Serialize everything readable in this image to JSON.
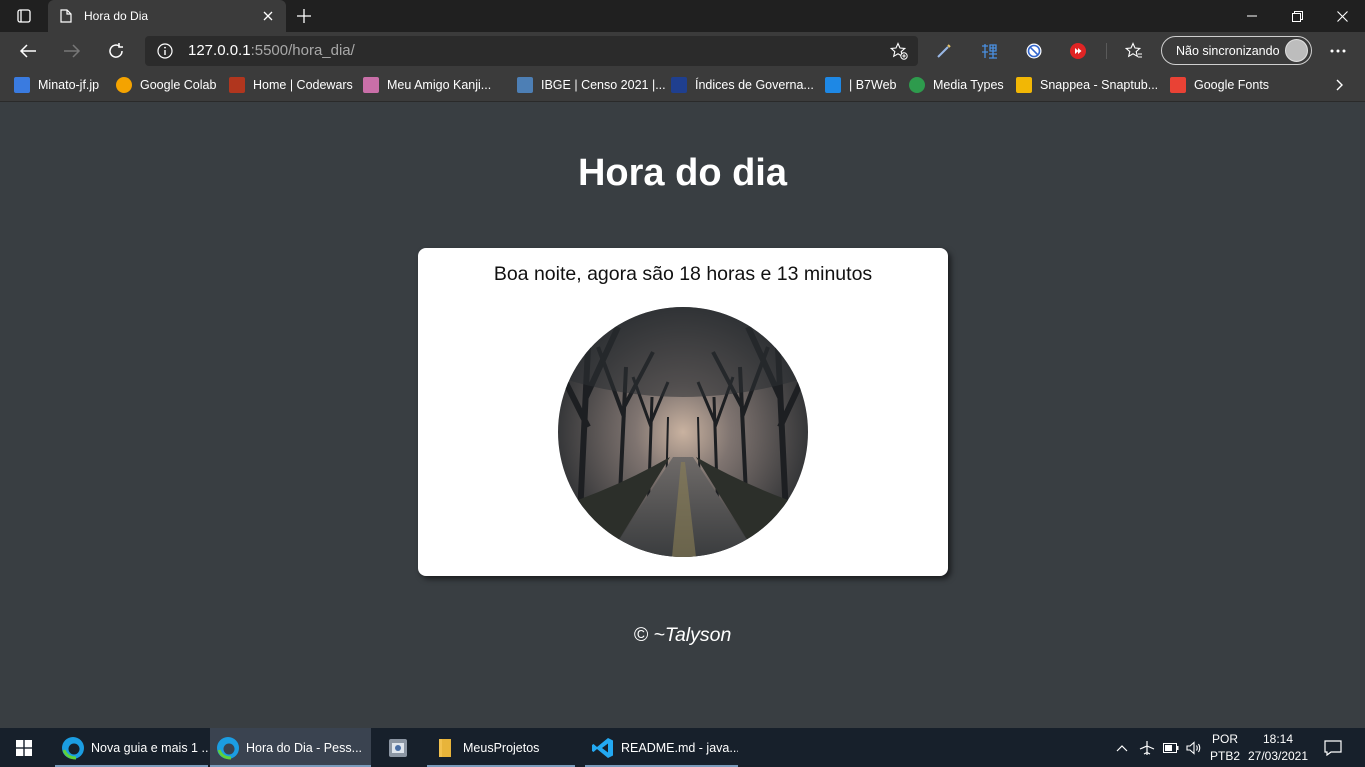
{
  "browser": {
    "tab": {
      "title": "Hora do Dia"
    },
    "address": {
      "host": "127.0.0.1",
      "rest": ":5500/hora_dia/"
    },
    "profile_label": "Não sincronizando",
    "bookmarks": [
      {
        "label": "Minato-jf.jp",
        "color": "#3a7be0"
      },
      {
        "label": "Google Colab",
        "color": "#f4a300"
      },
      {
        "label": "Home | Codewars",
        "color": "#b1361e"
      },
      {
        "label": "Meu Amigo Kanji...",
        "color": "#c96fa8"
      },
      {
        "label": "IBGE | Censo 2021 |...",
        "color": "#4d7fb5"
      },
      {
        "label": "Índices de Governa...",
        "color": "#1f3f8f"
      },
      {
        "label": "| B7Web",
        "color": "#1e88e5"
      },
      {
        "label": "Media Types",
        "color": "#2e9b4d"
      },
      {
        "label": "Snappea - Snaptub...",
        "color": "#f2b705"
      },
      {
        "label": "Google Fonts",
        "color": "#e94235"
      }
    ]
  },
  "page": {
    "title": "Hora do dia",
    "message": "Boa noite, agora são 18 horas e 13 minutos",
    "footer": "© ~Talyson"
  },
  "taskbar": {
    "items": [
      {
        "label": "Nova guia e mais 1 ...",
        "active": false
      },
      {
        "label": "Hora do Dia - Pess...",
        "active": true
      },
      {
        "label": "",
        "active": false
      },
      {
        "label": "MeusProjetos",
        "active": false
      },
      {
        "label": "README.md - java...",
        "active": false
      }
    ],
    "lang_top": "POR",
    "lang_bottom": "PTB2",
    "time": "18:14",
    "date": "27/03/2021"
  }
}
